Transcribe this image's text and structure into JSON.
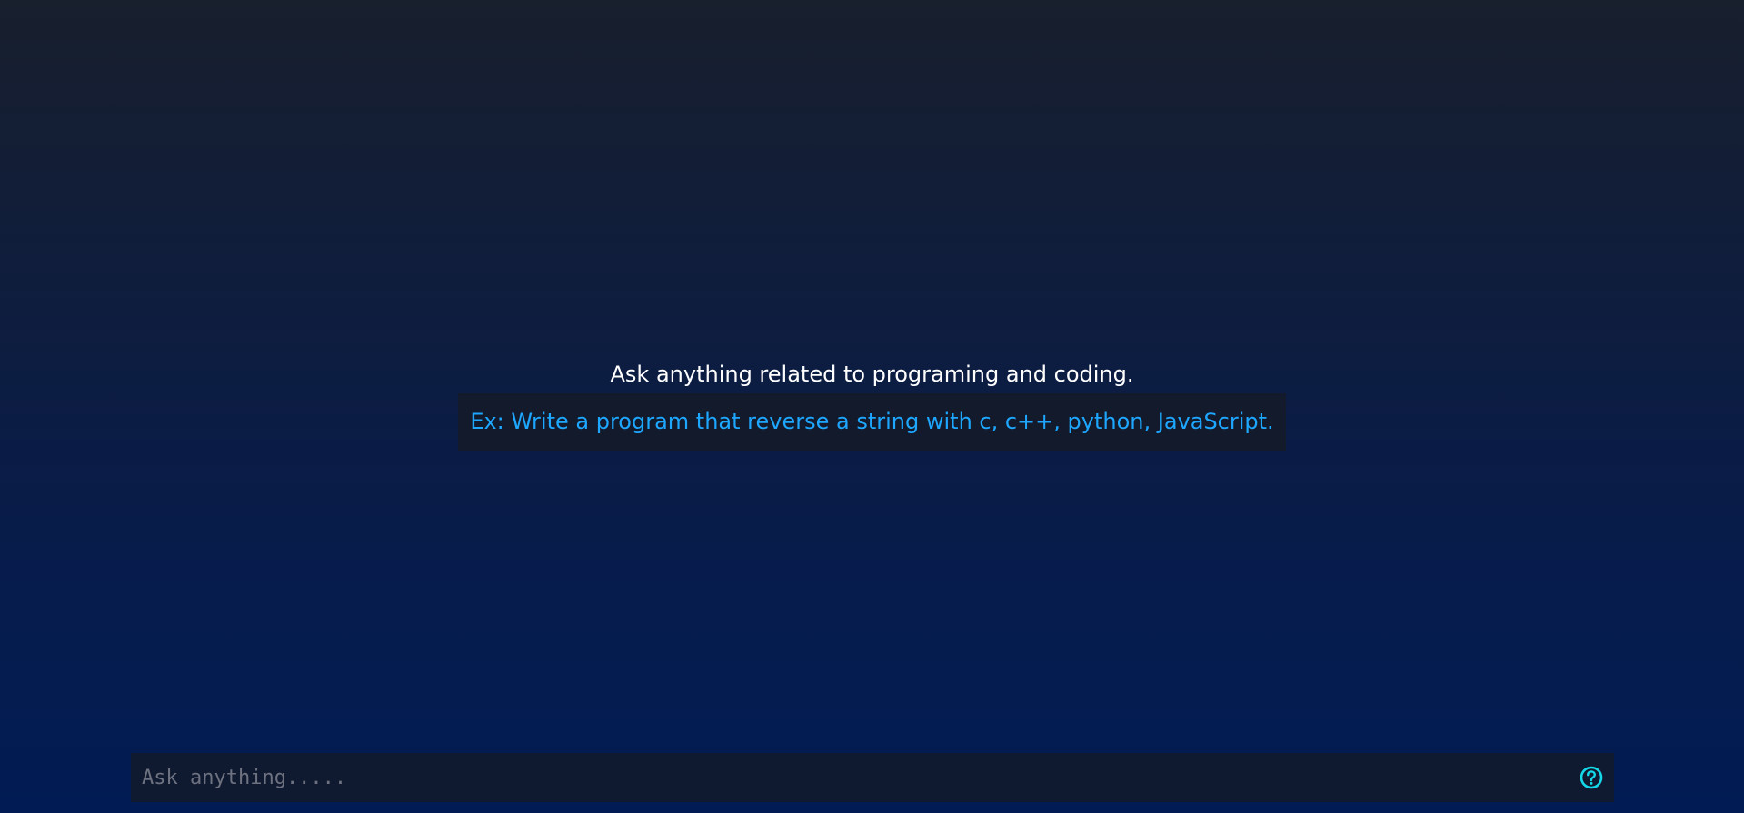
{
  "hero": {
    "title": "Ask anything related to programing and coding.",
    "example": "Ex: Write a program that reverse a string with c, c++, python, JavaScript."
  },
  "prompt": {
    "placeholder": "Ask anything....."
  },
  "icons": {
    "help": "question-circle-icon"
  },
  "colors": {
    "accent": "#1ea7ff",
    "help_icon": "#14d8e8",
    "input_background": "#0f1a30",
    "example_background": "#121a2c"
  }
}
